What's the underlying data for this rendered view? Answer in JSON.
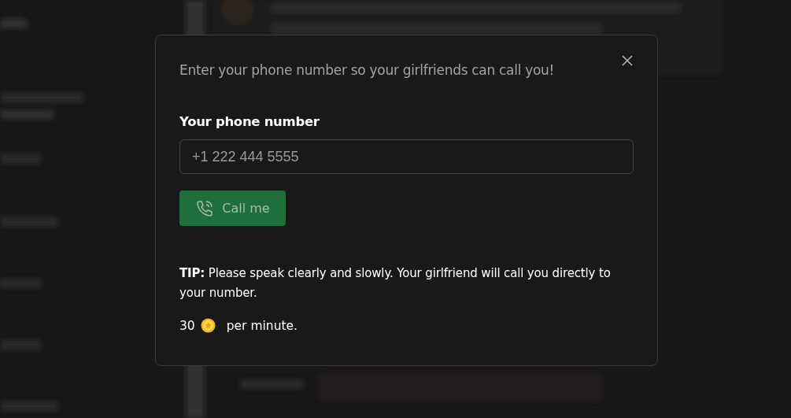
{
  "dialog": {
    "title": "Enter your phone number so your girlfriends can call you!",
    "field_label": "Your phone number",
    "phone_field": {
      "placeholder": "+1 222 444 5555"
    },
    "call_button": {
      "label": "Call me",
      "disabled": true
    },
    "tip": "**TIP:** Please speak clearly and slowly. Your girlfriend will call you directly to your number.",
    "price": {
      "amount": "30",
      "unit": "per minute."
    }
  }
}
